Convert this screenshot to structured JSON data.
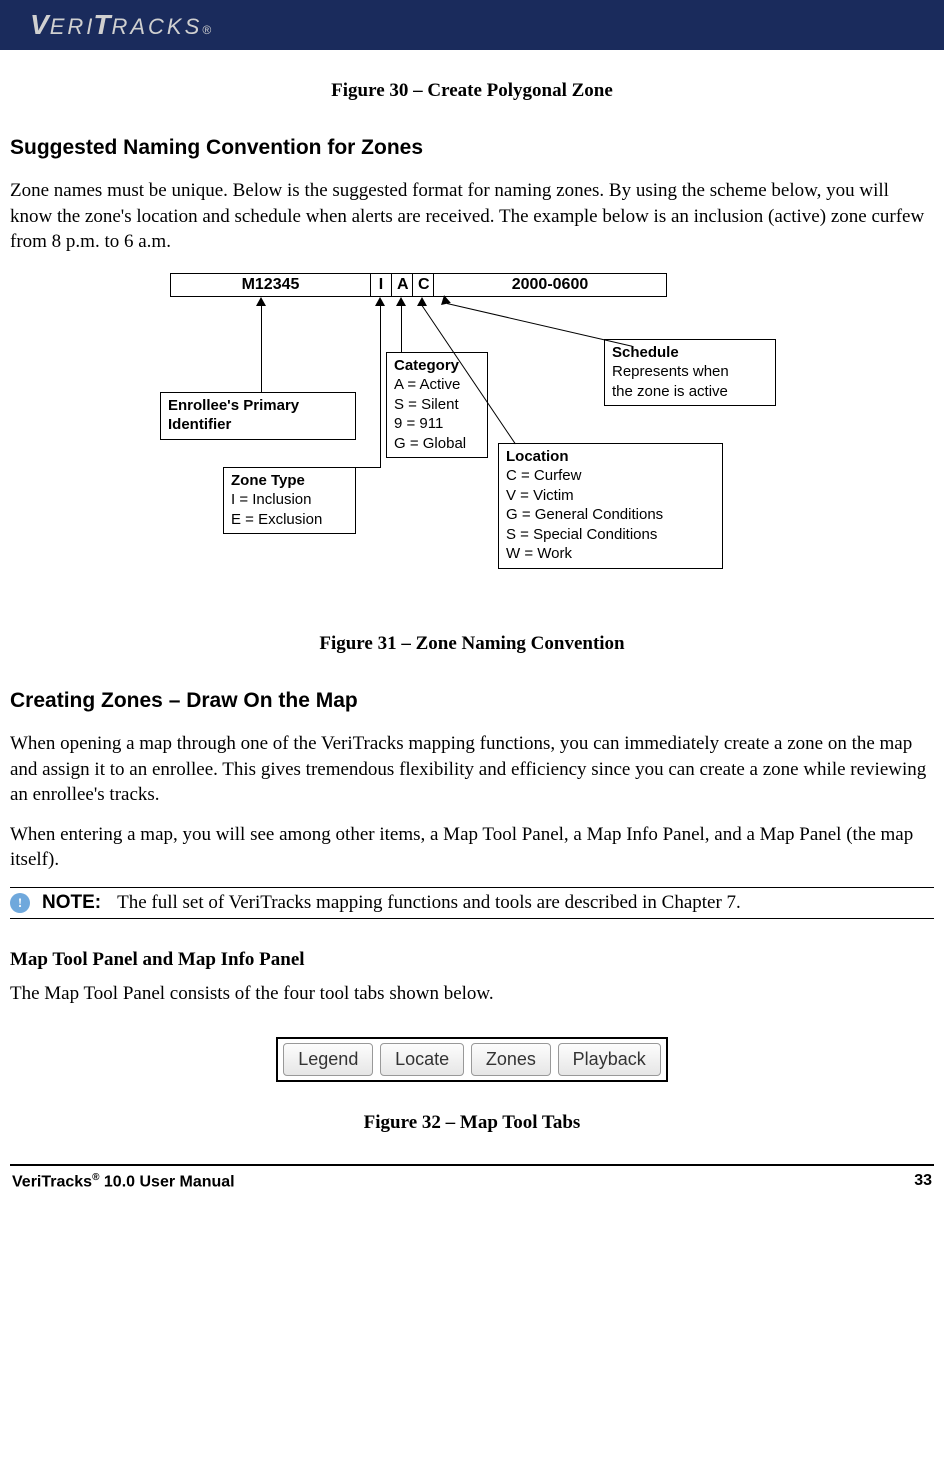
{
  "header": {
    "brand": "VERITRACKS",
    "reg": "®"
  },
  "fig30": "Figure 30 – Create Polygonal Zone",
  "sec1": {
    "heading": "Suggested Naming Convention for Zones",
    "para": "Zone names must be unique.  Below is the suggested format for naming zones. By using the scheme below, you will know the zone's location and schedule when alerts are received. The example below is an inclusion (active) zone curfew from 8 p.m. to 6 a.m."
  },
  "diagram": {
    "cells": {
      "id": "M12345",
      "a": "I",
      "b": "A",
      "c": "C",
      "sched": "2000-0600"
    },
    "enrollee": {
      "title": "Enrollee's Primary Identifier"
    },
    "zonetype": {
      "title": "Zone Type",
      "l1": "I = Inclusion",
      "l2": "E = Exclusion"
    },
    "category": {
      "title": "Category",
      "l1": "A = Active",
      "l2": "S = Silent",
      "l3": "9 = 911",
      "l4": "G = Global"
    },
    "location": {
      "title": "Location",
      "l1": "C = Curfew",
      "l2": "V = Victim",
      "l3": " G = General Conditions",
      "l4": "S = Special Conditions",
      "l5": "W = Work"
    },
    "schedule": {
      "title": "Schedule",
      "l1": "Represents when",
      "l2": "the zone is active"
    }
  },
  "fig31": "Figure 31 – Zone Naming Convention",
  "sec2": {
    "heading": "Creating Zones – Draw On the Map",
    "p1": "When opening a map through one of the VeriTracks mapping functions, you can immediately create a zone on the map and assign it to an enrollee. This gives tremendous flexibility and efficiency since you can create a zone while reviewing an enrollee's tracks.",
    "p2": "When entering a map, you will see among other items, a Map Tool Panel, a Map Info Panel, and a Map Panel (the map itself)."
  },
  "note": {
    "icon": "!",
    "label": "NOTE:",
    "text": "The full set of VeriTracks mapping functions and tools are described in Chapter 7."
  },
  "sub": {
    "heading": "Map Tool Panel and Map Info Panel",
    "p": "The Map Tool Panel consists of the four tool tabs shown below."
  },
  "tabs": {
    "t1": "Legend",
    "t2": "Locate",
    "t3": "Zones",
    "t4": "Playback"
  },
  "fig32": "Figure 32 – Map Tool Tabs",
  "footer": {
    "left": "VeriTracks® 10.0 User Manual",
    "right": "33"
  }
}
